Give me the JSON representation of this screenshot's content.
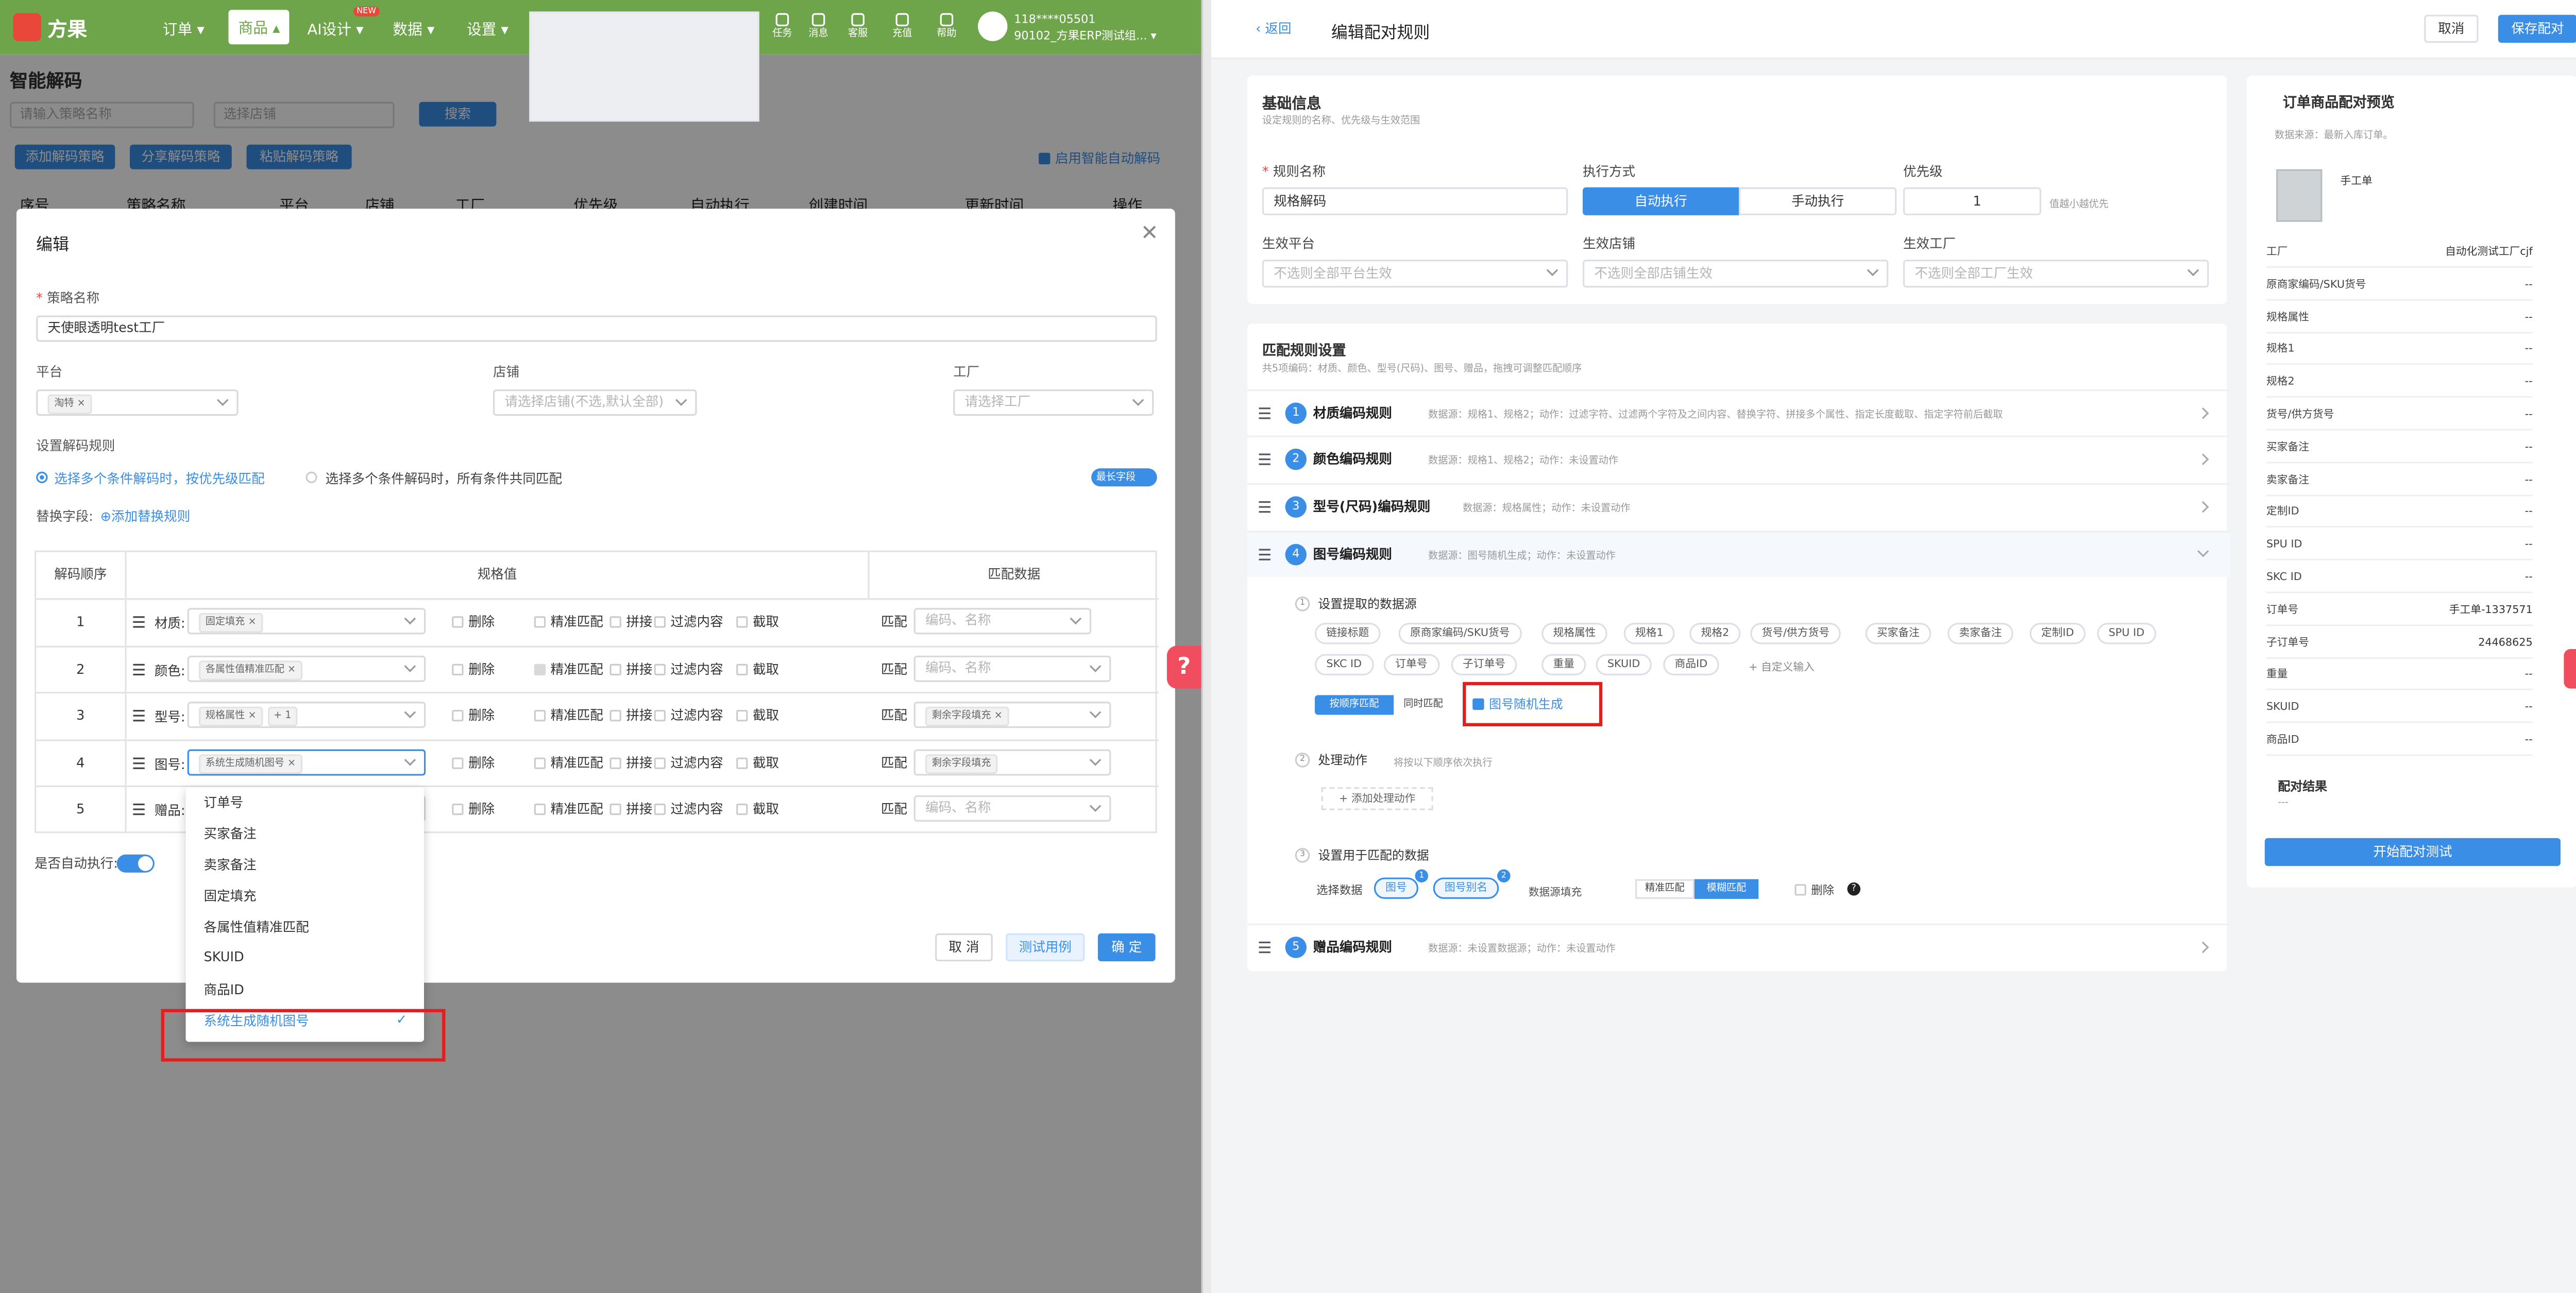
{
  "left_app": {
    "brand": "方果",
    "nav": [
      {
        "label": "订单 ▾"
      },
      {
        "label": "商品 ▴"
      },
      {
        "label": "AI设计 ▾",
        "badge": "NEW"
      },
      {
        "label": "数据 ▾"
      },
      {
        "label": "设置 ▾"
      }
    ],
    "tools": [
      "任务",
      "消息",
      "客服",
      "充值",
      "帮助"
    ],
    "user_line1": "118****05501",
    "user_line2": "90102_方果ERP测试组... ▾",
    "page_title": "智能解码",
    "filter_strategy_placeholder": "请输入策略名称",
    "filter_shop_placeholder": "选择店铺",
    "search_button": "搜索",
    "actions": {
      "add": "添加解码策略",
      "share": "分享解码策略",
      "paste": "粘贴解码策略"
    },
    "auto_decode_label": "启用智能自动解码",
    "table_headers": [
      "序号",
      "策略名称",
      "平台",
      "店铺",
      "工厂",
      "优先级",
      "自动执行",
      "创建时间",
      "更新时间",
      "操作"
    ]
  },
  "dialog": {
    "title": "编辑",
    "strategy_name_label": "策略名称",
    "strategy_name_value": "天使眼透明test工厂",
    "platform_label": "平台",
    "platform_tag": "淘特",
    "shop_label": "店铺",
    "shop_placeholder": "请选择店铺(不选,默认全部)",
    "factory_label": "工厂",
    "factory_placeholder": "请选择工厂",
    "decode_rule_label": "设置解码规则",
    "rule_option_1": "选择多个条件解码时，按优先级匹配",
    "rule_option_2": "选择多个条件解码时，所有条件共同匹配",
    "longest_toggle_label": "最长字段",
    "replace_label": "替换字段:",
    "add_replace_rule": "⊕添加替换规则",
    "table_headers": {
      "order": "解码顺序",
      "spec": "规格值",
      "match": "匹配数据"
    },
    "option_labels": [
      "删除",
      "精准匹配",
      "拼接",
      "过滤内容",
      "截取"
    ],
    "match_prefix": "匹配",
    "rows": [
      {
        "num": "1",
        "name": "材质:",
        "tag": "固定填充",
        "match_value": "编码、名称",
        "match_is_placeholder": true
      },
      {
        "num": "2",
        "name": "颜色:",
        "tag": "各属性值精准匹配",
        "match_value": "编码、名称",
        "match_is_placeholder": true
      },
      {
        "num": "3",
        "name": "型号:",
        "tag": "规格属性",
        "extra_tag": "+ 1",
        "match_value": "剩余字段填充",
        "match_is_placeholder": false
      },
      {
        "num": "4",
        "name": "图号:",
        "tag": "系统生成随机图号",
        "match_value": "剩余字段填充",
        "match_is_placeholder": false
      },
      {
        "num": "5",
        "name": "赠品:",
        "tag": "",
        "match_value": "编码、名称",
        "match_is_placeholder": true
      }
    ],
    "auto_exec_label": "是否自动执行:",
    "buttons": {
      "cancel": "取 消",
      "test": "测试用例",
      "ok": "确 定"
    }
  },
  "dropdown": {
    "items": [
      "订单号",
      "买家备注",
      "卖家备注",
      "固定填充",
      "各属性值精准匹配",
      "SKUID",
      "商品ID",
      "系统生成随机图号"
    ],
    "selected": "系统生成随机图号",
    "check_mark": "✓"
  },
  "help_float": "?",
  "right_app": {
    "back": "返回",
    "title": "编辑配对规则",
    "cancel": "取消",
    "save": "保存配对",
    "basic_info": {
      "title": "基础信息",
      "subtitle": "设定规则的名称、优先级与生效范围",
      "rule_name_label": "规则名称",
      "rule_name_value": "规格解码",
      "exec_label": "执行方式",
      "exec_auto": "自动执行",
      "exec_manual": "手动执行",
      "priority_label": "优先级",
      "priority_value": "1",
      "priority_hint": "值越小越优先",
      "platform_label": "生效平台",
      "platform_placeholder": "不选则全部平台生效",
      "shop_label": "生效店铺",
      "shop_placeholder": "不选则全部店铺生效",
      "factory_label": "生效工厂",
      "factory_placeholder": "不选则全部工厂生效"
    },
    "match_settings": {
      "title": "匹配规则设置",
      "subtitle": "共5项编码：材质、颜色、型号(尺码)、图号、赠品，拖拽可调整匹配顺序",
      "rules": [
        {
          "num": "1",
          "name": "材质编码规则",
          "desc": "数据源：规格1、规格2；动作：过滤字符、过滤两个字符及之间内容、替换字符、拼接多个属性、指定长度截取、指定字符前后截取"
        },
        {
          "num": "2",
          "name": "颜色编码规则",
          "desc": "数据源：规格1、规格2；动作：未设置动作"
        },
        {
          "num": "3",
          "name": "型号(尺码)编码规则",
          "desc": "数据源：规格属性；动作：未设置动作"
        },
        {
          "num": "4",
          "name": "图号编码规则",
          "desc": "数据源：图号随机生成；动作：未设置动作"
        },
        {
          "num": "5",
          "name": "赠品编码规则",
          "desc": "数据源：未设置数据源；动作：未设置动作"
        }
      ],
      "step1_title": "设置提取的数据源",
      "sources_row1": [
        "链接标题",
        "原商家编码/SKU货号",
        "规格属性",
        "规格1",
        "规格2",
        "货号/供方货号",
        "买家备注",
        "卖家备注",
        "定制ID",
        "SPU ID"
      ],
      "sources_row2": [
        "SKC ID",
        "订单号",
        "子订单号",
        "重量",
        "SKUID",
        "商品ID"
      ],
      "custom_input": "+ 自定义输入",
      "order_match": "按顺序匹配",
      "simultaneous_match": "同时匹配",
      "random_figure": "图号随机生成",
      "step2_title": "处理动作",
      "step2_hint": "将按以下顺序依次执行",
      "add_action": "+ 添加处理动作",
      "step3_title": "设置用于匹配的数据",
      "select_data": "选择数据",
      "match_chip_1": "图号",
      "match_chip_1_badge": "1",
      "match_chip_2": "图号别名",
      "match_chip_2_badge": "2",
      "source_fill": "数据源填充",
      "exact_match": "精准匹配",
      "fuzzy_match": "模糊匹配",
      "delete_label": "删除",
      "help_icon": "?"
    },
    "preview": {
      "title": "订单商品配对预览",
      "source": "数据来源：最新入库订单。",
      "product_name": "手工单",
      "fields": [
        {
          "label": "工厂",
          "value": "自动化测试工厂cjf"
        },
        {
          "label": "原商家编码/SKU货号",
          "value": "--"
        },
        {
          "label": "规格属性",
          "value": "--"
        },
        {
          "label": "规格1",
          "value": "--"
        },
        {
          "label": "规格2",
          "value": "--"
        },
        {
          "label": "货号/供方货号",
          "value": "--"
        },
        {
          "label": "买家备注",
          "value": "--"
        },
        {
          "label": "卖家备注",
          "value": "--"
        },
        {
          "label": "定制ID",
          "value": "--"
        },
        {
          "label": "SPU ID",
          "value": "--"
        },
        {
          "label": "SKC ID",
          "value": "--"
        },
        {
          "label": "订单号",
          "value": "手工单-1337571"
        },
        {
          "label": "子订单号",
          "value": "24468625"
        },
        {
          "label": "重量",
          "value": "--"
        },
        {
          "label": "SKUID",
          "value": "--"
        },
        {
          "label": "商品ID",
          "value": "--"
        }
      ],
      "result_title": "配对结果",
      "result_value": "---",
      "start_button": "开始配对测试"
    }
  },
  "colors": {
    "accent": "#3a8ee6",
    "nav_green": "#6ea44a",
    "highlight_red": "#e02020"
  }
}
